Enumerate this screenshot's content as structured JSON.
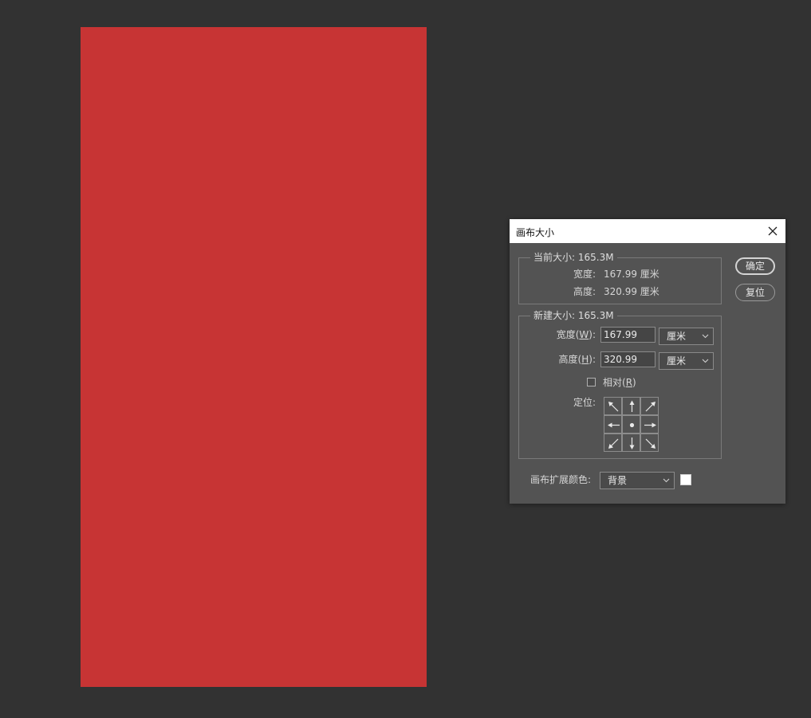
{
  "document_canvas": {
    "fill_color": "#c73434"
  },
  "dialog": {
    "title": "画布大小",
    "ok_label": "确定",
    "reset_label": "复位",
    "current_size": {
      "legend": "当前大小: 165.3M",
      "width_label": "宽度:",
      "width_value": "167.99 厘米",
      "height_label": "高度:",
      "height_value": "320.99 厘米"
    },
    "new_size": {
      "legend": "新建大小: 165.3M",
      "width_label_prefix": "宽度(",
      "width_label_key": "W",
      "width_label_suffix": "):",
      "width_value": "167.99",
      "width_unit": "厘米",
      "height_label_prefix": "高度(",
      "height_label_key": "H",
      "height_label_suffix": "):",
      "height_value": "320.99",
      "height_unit": "厘米",
      "relative_label_prefix": "相对(",
      "relative_label_key": "R",
      "relative_label_suffix": ")",
      "relative_checked": false,
      "anchor_label": "定位:"
    },
    "extension_color": {
      "label": "画布扩展颜色:",
      "value": "背景",
      "swatch_color": "#ffffff"
    }
  }
}
